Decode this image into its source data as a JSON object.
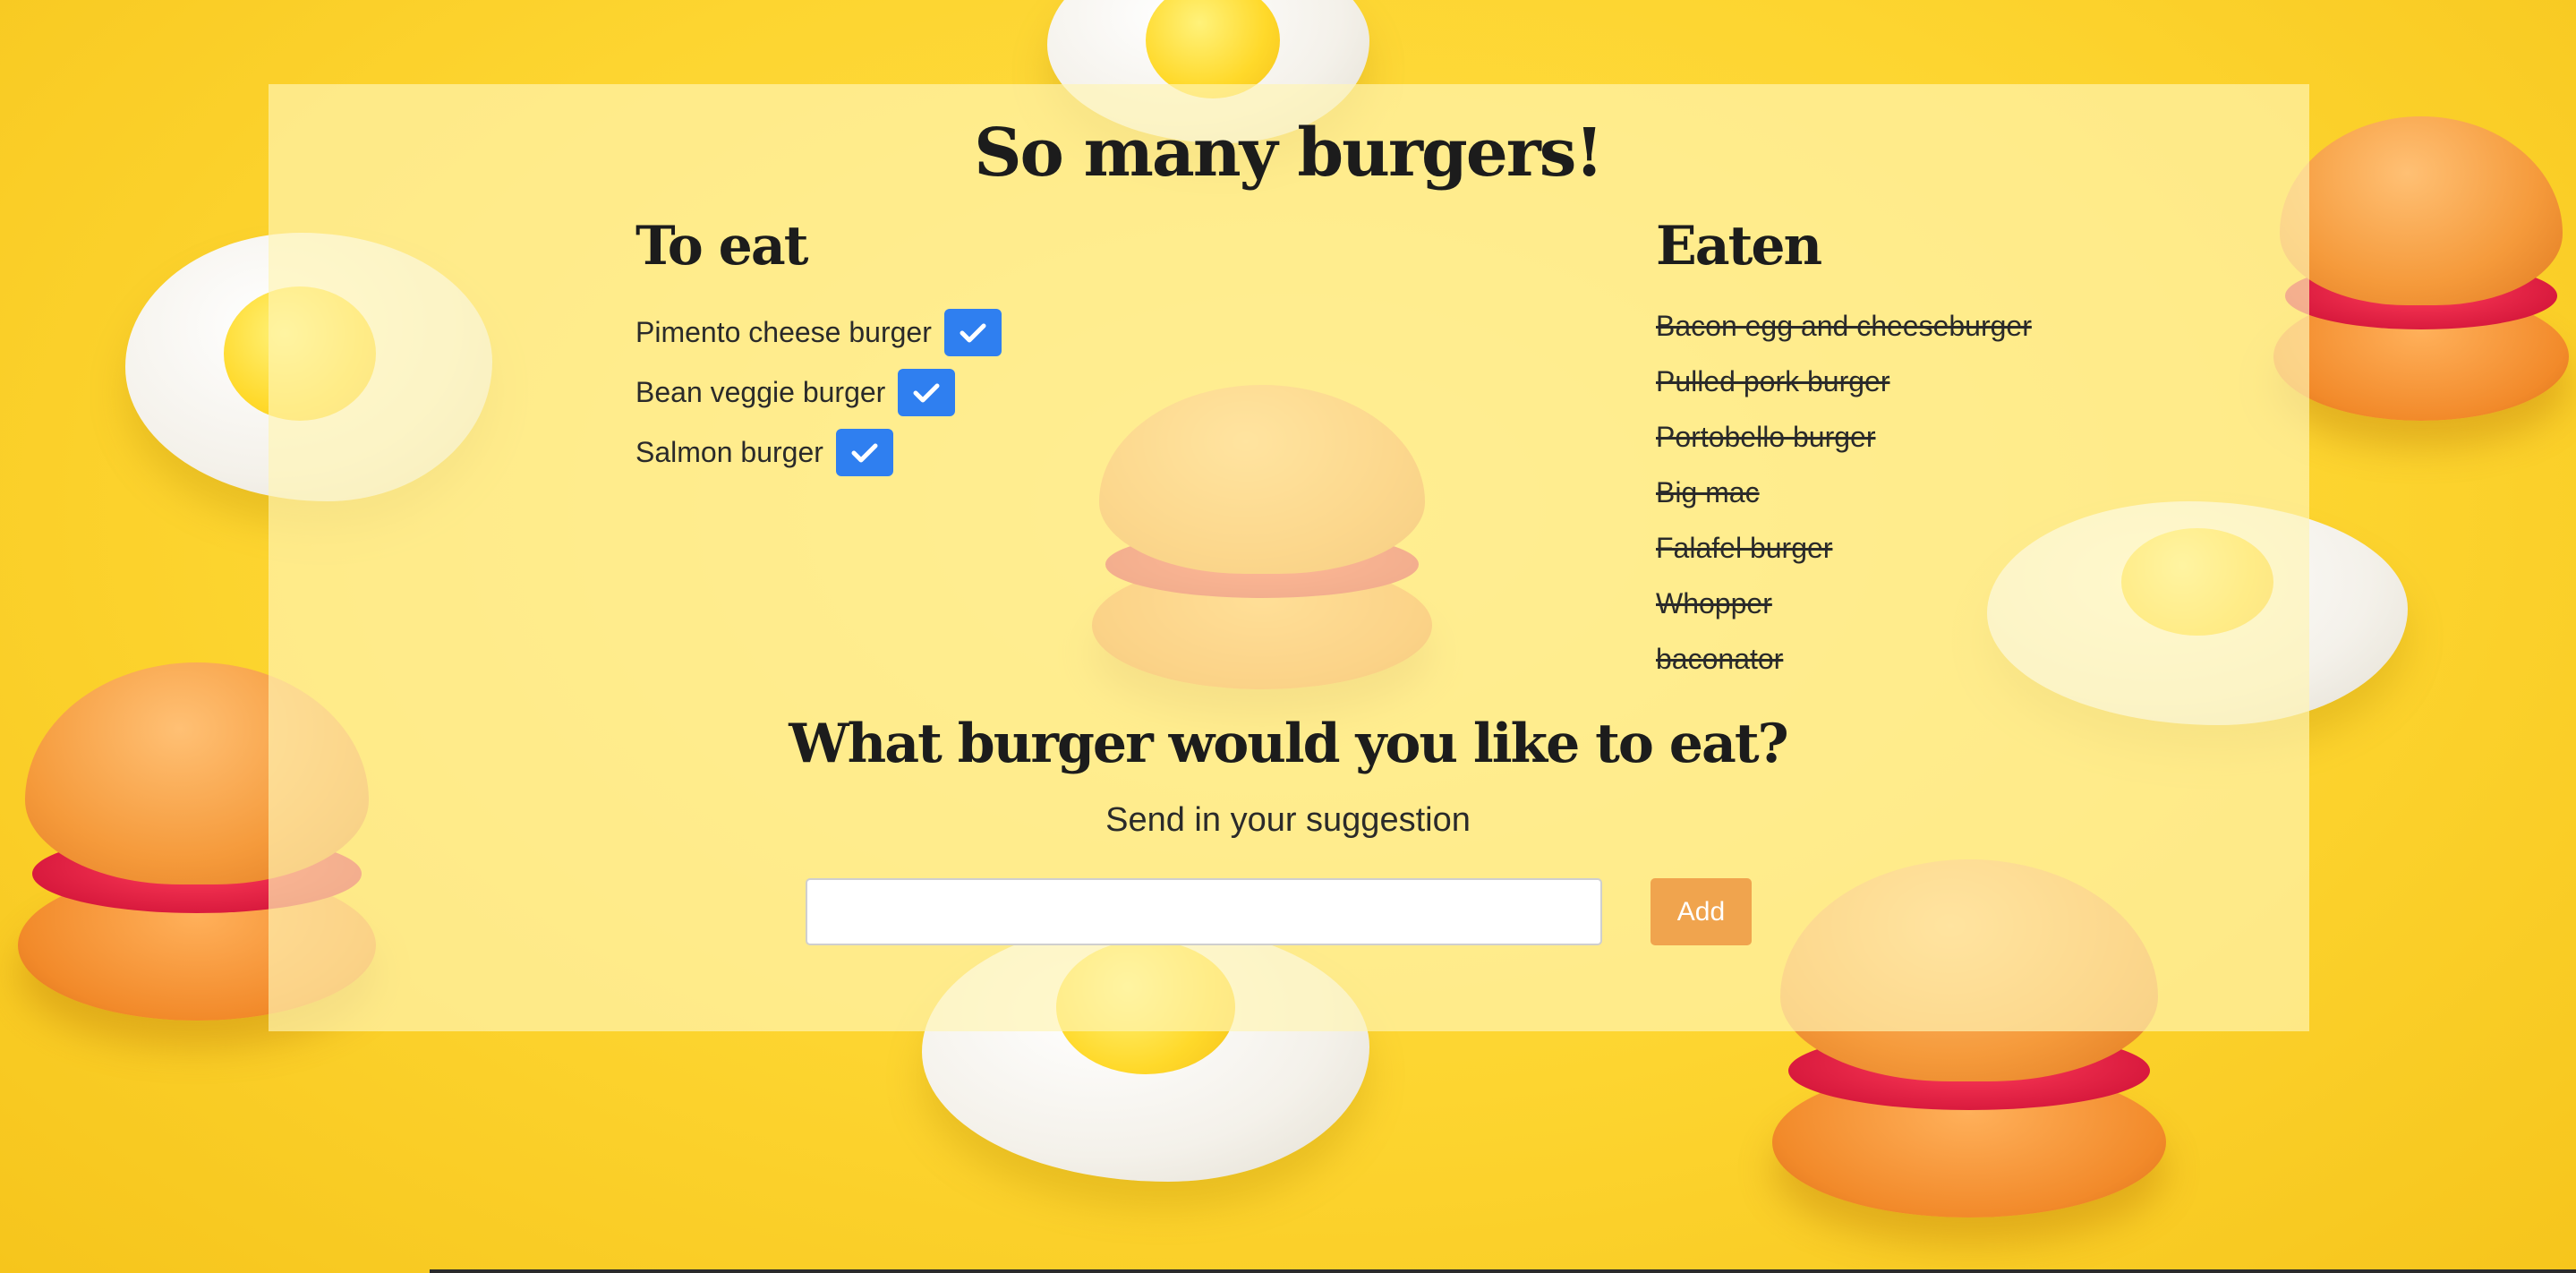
{
  "page": {
    "title": "So many burgers!"
  },
  "to_eat": {
    "heading": "To eat",
    "items": [
      {
        "label": "Pimento cheese burger"
      },
      {
        "label": "Bean veggie burger"
      },
      {
        "label": "Salmon burger"
      }
    ]
  },
  "eaten": {
    "heading": "Eaten",
    "items": [
      "Bacon egg and cheeseburger",
      "Pulled pork burger",
      "Portobello burger",
      "Big mac",
      "Falafel burger",
      "Whopper",
      "baconator"
    ]
  },
  "suggest": {
    "heading": "What burger would you like to eat?",
    "subheading": "Send in your suggestion",
    "input_value": "",
    "add_label": "Add"
  },
  "icons": {
    "check": "checkmark-icon"
  },
  "colors": {
    "background": "#fdd732",
    "panel": "rgba(255,245,180,0.68)",
    "check_button": "#2f7ff0",
    "add_button": "#f0a44e"
  }
}
